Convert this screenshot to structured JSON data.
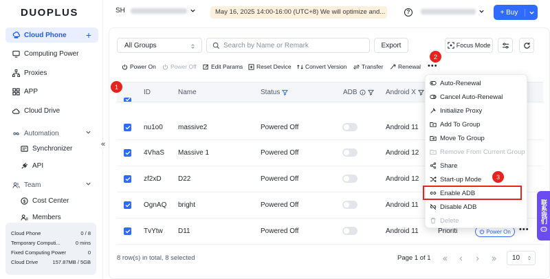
{
  "brand": {
    "logo_text": "DUOPLUS"
  },
  "sidebar": {
    "items": [
      {
        "label": "Cloud Phone",
        "icon": "cloud-phone-icon",
        "active": true
      },
      {
        "label": "Computing Power",
        "icon": "monitor-icon"
      },
      {
        "label": "Proxies",
        "icon": "proxy-icon"
      },
      {
        "label": "APP",
        "icon": "app-grid-icon"
      },
      {
        "label": "Cloud Drive",
        "icon": "cloud-icon"
      }
    ],
    "automation": {
      "label": "Automation",
      "children": [
        "Synchronizer",
        "API"
      ]
    },
    "team": {
      "label": "Team",
      "children": [
        "Cost Center",
        "Members"
      ]
    },
    "stats": [
      {
        "label": "Cloud Phone",
        "value": "0 / 8"
      },
      {
        "label": "Temporary Computi...",
        "value": "0 mins"
      },
      {
        "label": "Fixed Computing Power",
        "value": "0"
      },
      {
        "label": "Cloud Drive",
        "value": "157.87MB / 5GB"
      }
    ],
    "collapse_glyph": "«"
  },
  "header": {
    "account_initials": "SH",
    "notice": "May 16, 2025 14:00-16:00 (UTC+8) We will optimize and...",
    "help_glyph": "?",
    "buy_label": "+ Buy"
  },
  "filters": {
    "group_select": "All Groups",
    "search_placeholder": "Search by Name or Remark",
    "export_label": "Export",
    "focus_mode_label": "Focus Mode"
  },
  "toolbar": {
    "actions": [
      {
        "label": "Power On",
        "disabled": false
      },
      {
        "label": "Power Off",
        "disabled": true
      },
      {
        "label": "Edit Params",
        "disabled": false
      },
      {
        "label": "Reset Device",
        "disabled": false
      },
      {
        "label": "Convert Version",
        "disabled": false
      },
      {
        "label": "Transfer",
        "disabled": false
      },
      {
        "label": "Renewal",
        "disabled": false
      }
    ],
    "more_glyph": "•••"
  },
  "table": {
    "columns": [
      "ID",
      "Name",
      "Status",
      "ADB",
      "Android X"
    ],
    "rows": [
      {
        "id": "nu1o0",
        "name": "massive2",
        "status": "Powered Off",
        "adb": false,
        "android": "Android 11",
        "checked": true
      },
      {
        "id": "4VhaS",
        "name": "Massive 1",
        "status": "Powered Off",
        "adb": false,
        "android": "Android 12",
        "checked": true
      },
      {
        "id": "zf2xD",
        "name": "D22",
        "status": "Powered Off",
        "adb": false,
        "android": "Android 12",
        "checked": true
      },
      {
        "id": "OgnAQ",
        "name": "bright",
        "status": "Powered Off",
        "adb": false,
        "android": "Android 11",
        "checked": true
      },
      {
        "id": "TvYtw",
        "name": "D11",
        "status": "Powered Off",
        "adb": false,
        "android": "Android 11",
        "checked": true
      }
    ],
    "priority_text": "Prioriti",
    "power_on_label": "Power On",
    "row_more_glyph": "•••"
  },
  "footer": {
    "summary": "8 row(s) in total, 8 selected",
    "page_label": "Page 1 of 1",
    "page_size": "10"
  },
  "dropdown_menu": {
    "items": [
      {
        "label": "Auto-Renewal",
        "icon": "auto-renew-icon",
        "disabled": false
      },
      {
        "label": "Cancel Auto-Renewal",
        "icon": "cancel-renew-icon",
        "disabled": false
      },
      {
        "label": "Initialize Proxy",
        "icon": "wrench-icon",
        "disabled": false
      },
      {
        "label": "Add To Group",
        "icon": "folder-add-icon",
        "disabled": false
      },
      {
        "label": "Move To Group",
        "icon": "folder-move-icon",
        "disabled": false
      },
      {
        "label": "Remove From Current Group",
        "icon": "folder-remove-icon",
        "disabled": true
      },
      {
        "label": "Share",
        "icon": "share-icon",
        "disabled": false
      },
      {
        "label": "Start-up Mode",
        "icon": "shuffle-icon",
        "disabled": false
      },
      {
        "label": "Enable ADB",
        "icon": "link-icon",
        "disabled": false
      },
      {
        "label": "Disable ADB",
        "icon": "link-off-icon",
        "disabled": false
      },
      {
        "label": "Delete",
        "icon": "trash-icon",
        "disabled": true
      }
    ]
  },
  "annotations": {
    "markers": [
      "1",
      "2",
      "3"
    ]
  },
  "contact_tab": {
    "text": "联系我们"
  },
  "colors": {
    "accent": "#2f6bff",
    "marker": "#e8231e",
    "notice_bg": "#fdf0dc",
    "contact": "#6a4cf0"
  }
}
